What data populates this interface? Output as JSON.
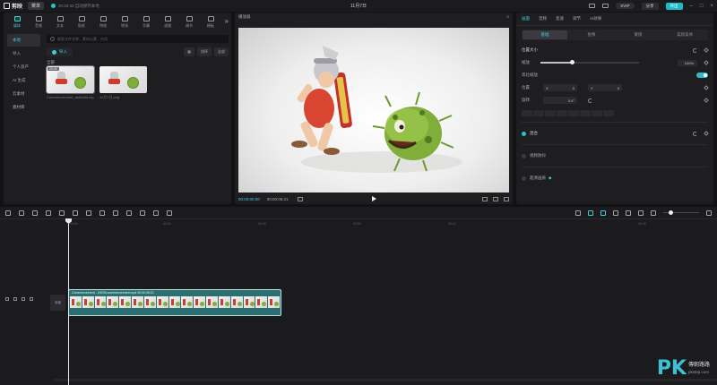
{
  "titlebar": {
    "app_name": "剪映",
    "menu_label": "菜单",
    "autosave_text": "20:40:33 自动保存本地",
    "project_title": "11月7日",
    "svip_label": "SVIP",
    "share_label": "分享",
    "export_label": "导出"
  },
  "media": {
    "tools": [
      "媒体",
      "音频",
      "文本",
      "贴纸",
      "特效",
      "转场",
      "字幕",
      "滤镜",
      "调节",
      "模板"
    ],
    "left_menu": [
      "本地",
      "导入",
      "个人资产",
      "AI 生成",
      "云素材",
      "素材库"
    ],
    "search_placeholder": "搜索文件名称、素材元素、台词",
    "import_label": "导入",
    "filters": [
      "排序",
      "全部"
    ],
    "all_label": "全部",
    "thumbs": [
      {
        "caption": "Commencement_autoadd.mp4",
        "duration": "00:06"
      },
      {
        "caption": "11月7日.png",
        "duration": ""
      }
    ]
  },
  "player": {
    "title": "播放器",
    "time_current": "00:00:00:00",
    "time_total": "00:00:06:21"
  },
  "props": {
    "tabs": [
      "画面",
      "音频",
      "变速",
      "调节",
      "AI效果"
    ],
    "subtabs": [
      "基础",
      "抠像",
      "蒙版",
      "美颜美体"
    ],
    "section_position": "位置大小",
    "scale_label": "缩放",
    "scale_value": "100%",
    "uniform_label": "等比缩放",
    "position_label": "位置",
    "x_label": "X",
    "x_value": "0",
    "y_label": "Y",
    "y_value": "0",
    "rotate_label": "旋转",
    "rotate_value": "0.0°",
    "blend_label": "混合",
    "stabilize_label": "视频防抖",
    "hd_label": "超清画质"
  },
  "timeline": {
    "ticks": [
      "00:00",
      "00:03",
      "00:06",
      "00:09",
      "00:12",
      "00:15"
    ],
    "cover_label": "封面",
    "clip_title": "Commencement - 24039-commencement.mp4  00:00:06:21"
  },
  "watermark": {
    "brand": "PK",
    "line1": "傳朝路路",
    "line2": "pkstep.com"
  }
}
